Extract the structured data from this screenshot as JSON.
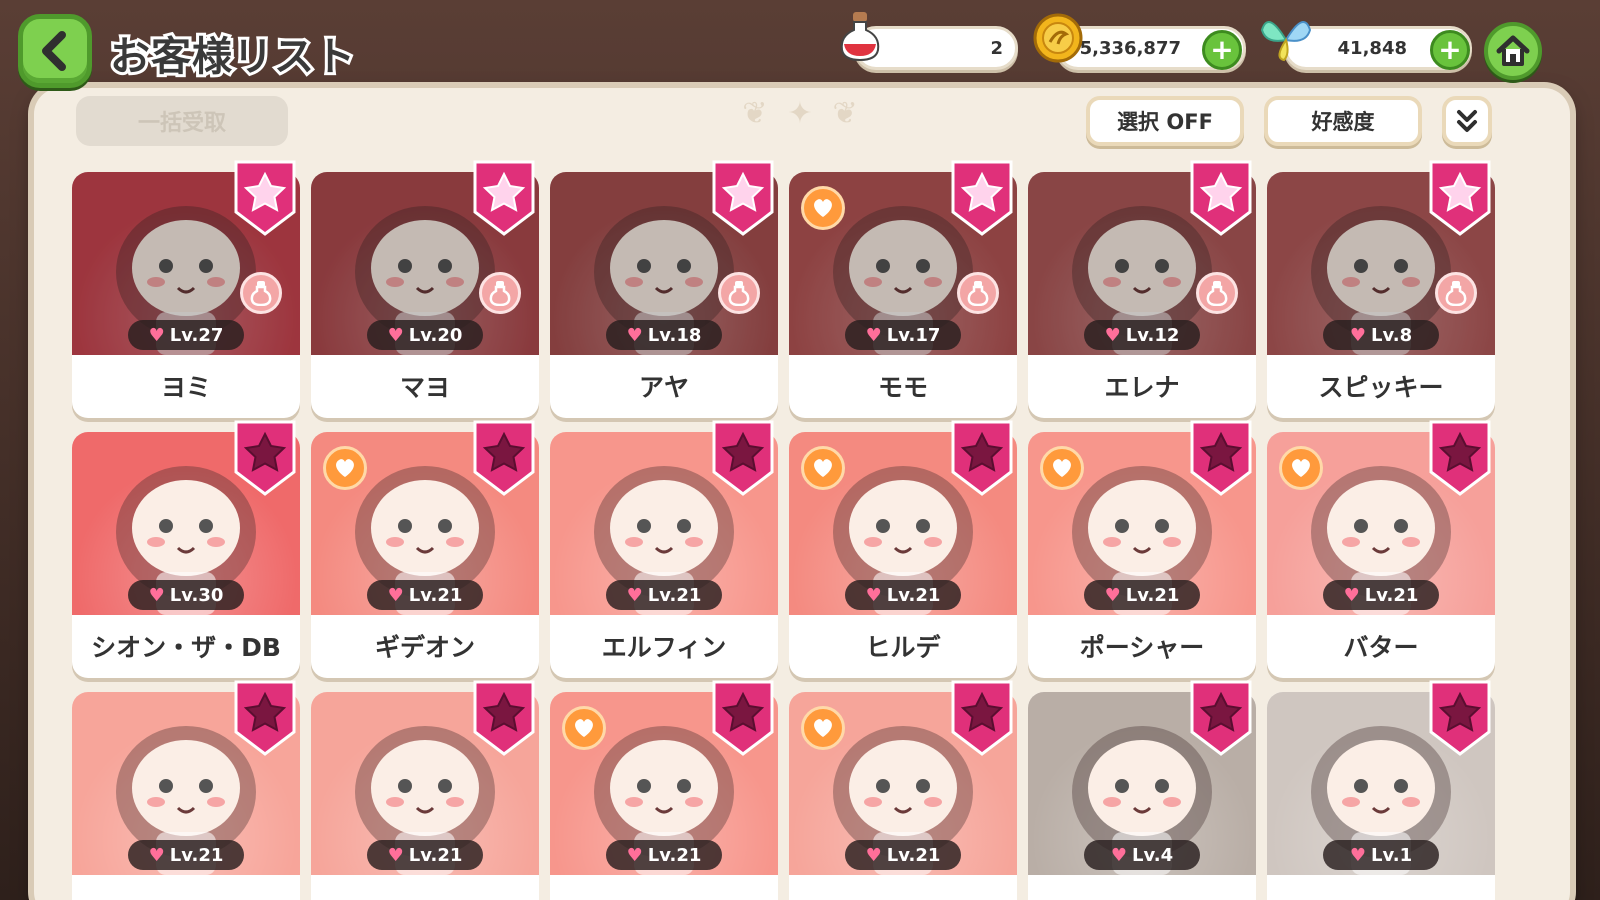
{
  "header": {
    "title": "お客様リスト"
  },
  "resources": {
    "potion": "2",
    "gold": "5,336,877",
    "gem": "41,848"
  },
  "toolbar": {
    "bulk_label": "一括受取",
    "select_label": "選択 OFF",
    "sort_label": "好感度"
  },
  "colors": {
    "accent_green": "#7ed04f",
    "badge_pink": "#e0307a",
    "badge_dark": "#7a1640",
    "heart_orange": "#ff9a3c"
  },
  "cards": [
    {
      "name": "ヨミ",
      "level": "Lv.27",
      "star": "bright",
      "heart": false,
      "bottle": true,
      "bg": "#c9444f"
    },
    {
      "name": "マヨ",
      "level": "Lv.20",
      "star": "bright",
      "heart": false,
      "bottle": true,
      "bg": "#b04a4e"
    },
    {
      "name": "アヤ",
      "level": "Lv.18",
      "star": "bright",
      "heart": false,
      "bottle": true,
      "bg": "#a95050"
    },
    {
      "name": "モモ",
      "level": "Lv.17",
      "star": "bright",
      "heart": true,
      "bottle": true,
      "bg": "#b55555"
    },
    {
      "name": "エレナ",
      "level": "Lv.12",
      "star": "bright",
      "heart": false,
      "bottle": true,
      "bg": "#b05858"
    },
    {
      "name": "スピッキー",
      "level": "Lv.8",
      "star": "bright",
      "heart": false,
      "bottle": true,
      "bg": "#b45a5a"
    },
    {
      "name": "シオン・ザ・DB",
      "level": "Lv.30",
      "star": "dark",
      "heart": false,
      "bottle": false,
      "bg": "#ef6a6a"
    },
    {
      "name": "ギデオン",
      "level": "Lv.21",
      "star": "dark",
      "heart": true,
      "bottle": false,
      "bg": "#f48a80"
    },
    {
      "name": "エルフィン",
      "level": "Lv.21",
      "star": "dark",
      "heart": false,
      "bottle": false,
      "bg": "#f7968c"
    },
    {
      "name": "ヒルデ",
      "level": "Lv.21",
      "star": "dark",
      "heart": true,
      "bottle": false,
      "bg": "#f48a80"
    },
    {
      "name": "ポーシャー",
      "level": "Lv.21",
      "star": "dark",
      "heart": true,
      "bottle": false,
      "bg": "#f7968c"
    },
    {
      "name": "バター",
      "level": "Lv.21",
      "star": "dark",
      "heart": true,
      "bottle": false,
      "bg": "#f6a09a"
    },
    {
      "name": "",
      "level": "Lv.21",
      "star": "dark",
      "heart": false,
      "bottle": false,
      "bg": "#f7a59a"
    },
    {
      "name": "",
      "level": "Lv.21",
      "star": "dark",
      "heart": false,
      "bottle": false,
      "bg": "#f6a59a"
    },
    {
      "name": "",
      "level": "Lv.21",
      "star": "dark",
      "heart": true,
      "bottle": false,
      "bg": "#f7968c"
    },
    {
      "name": "",
      "level": "Lv.21",
      "star": "dark",
      "heart": true,
      "bottle": false,
      "bg": "#f6a59a"
    },
    {
      "name": "",
      "level": "Lv.4",
      "star": "dark",
      "heart": false,
      "bottle": false,
      "bg": "#b9aea6"
    },
    {
      "name": "",
      "level": "Lv.1",
      "star": "dark",
      "heart": false,
      "bottle": false,
      "bg": "#cfc6c0"
    }
  ]
}
